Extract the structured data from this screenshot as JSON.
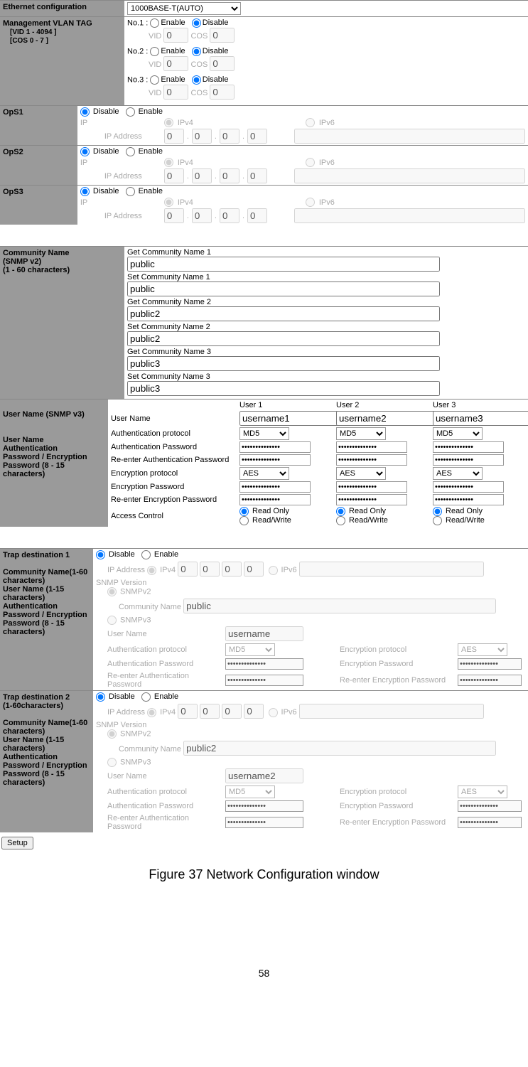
{
  "ethernet": {
    "label": "Ethernet configuration",
    "value": "1000BASE-T(AUTO)"
  },
  "vlan": {
    "label": "Management VLAN TAG",
    "sub1": "[VID 1 - 4094 ]",
    "sub2": "[COS 0 - 7 ]",
    "rows": [
      {
        "no": "No.1 :",
        "enable": "Enable",
        "disable": "Disable",
        "vid": "VID",
        "vidv": "0",
        "cos": "COS",
        "cosv": "0"
      },
      {
        "no": "No.2 :",
        "enable": "Enable",
        "disable": "Disable",
        "vid": "VID",
        "vidv": "0",
        "cos": "COS",
        "cosv": "0"
      },
      {
        "no": "No.3 :",
        "enable": "Enable",
        "disable": "Disable",
        "vid": "VID",
        "vidv": "0",
        "cos": "COS",
        "cosv": "0"
      }
    ]
  },
  "ops": {
    "items": [
      {
        "label": "OpS1"
      },
      {
        "label": "OpS2"
      },
      {
        "label": "OpS3"
      }
    ],
    "disable": "Disable",
    "enable": "Enable",
    "ip": "IP",
    "ipv4": "IPv4",
    "ipv6": "IPv6",
    "ipaddr": "IP Address",
    "oct": "0"
  },
  "comm": {
    "label": "Community Name\n(SNMP v2)\n(1 - 60 characters)",
    "rows": [
      {
        "lbl": "Get Community Name 1",
        "val": "public"
      },
      {
        "lbl": "Set Community Name 1",
        "val": "public"
      },
      {
        "lbl": "Get Community Name 2",
        "val": "public2"
      },
      {
        "lbl": "Set Community Name 2",
        "val": "public2"
      },
      {
        "lbl": "Get Community Name 3",
        "val": "public3"
      },
      {
        "lbl": "Set Community Name 3",
        "val": "public3"
      }
    ]
  },
  "snmpv3": {
    "label": "User Name (SNMP v3)",
    "desc": "User Name\nAuthentication\nPassword / Encryption\nPassword (8 - 15\ncharacters)",
    "cols": [
      "User 1",
      "User 2",
      "User 3"
    ],
    "rows": {
      "uname": "User Name",
      "authp": "Authentication protocol",
      "authpw": "Authentication Password",
      "reauthpw": "Re-enter Authentication Password",
      "encp": "Encryption protocol",
      "encpw": "Encryption Password",
      "reencpw": "Re-enter Encryption Password",
      "access": "Access Control",
      "ro": "Read Only",
      "rw": "Read/Write"
    },
    "users": [
      {
        "name": "username1",
        "auth": "MD5",
        "enc": "AES"
      },
      {
        "name": "username2",
        "auth": "MD5",
        "enc": "AES"
      },
      {
        "name": "username3",
        "auth": "MD5",
        "enc": "AES"
      }
    ]
  },
  "traps": [
    {
      "title": "Trap destination 1",
      "desc": "Community Name(1-60\ncharacters)\nUser Name (1-15\ncharacters)\nAuthentication\nPassword / Encryption\nPassword (8 - 15\ncharacters)",
      "comm": "public",
      "uname": "username",
      "auth": "MD5",
      "enc": "AES"
    },
    {
      "title": "Trap destination 2\n(1-60characters)",
      "desc": "Community Name(1-60\ncharacters)\nUser Name (1-15\ncharacters)\nAuthentication\nPassword / Encryption\nPassword (8 - 15\ncharacters)",
      "comm": "public2",
      "uname": "username2",
      "auth": "MD5",
      "enc": "AES"
    }
  ],
  "trap_labels": {
    "disable": "Disable",
    "enable": "Enable",
    "ipaddr": "IP Address",
    "ipv4": "IPv4",
    "ipv6": "IPv6",
    "snmpver": "SNMP Version",
    "snmpv2": "SNMPv2",
    "snmpv3": "SNMPv3",
    "commname": "Community Name",
    "uname": "User Name",
    "authp": "Authentication protocol",
    "encp": "Encryption protocol",
    "authpw": "Authentication Password",
    "encpw": "Encryption Password",
    "reauthpw": "Re-enter Authentication Password",
    "reencpw": "Re-enter Encryption Password",
    "oct": "0"
  },
  "setup": "Setup",
  "caption": "Figure 37 Network Configuration window",
  "pagenum": "58"
}
